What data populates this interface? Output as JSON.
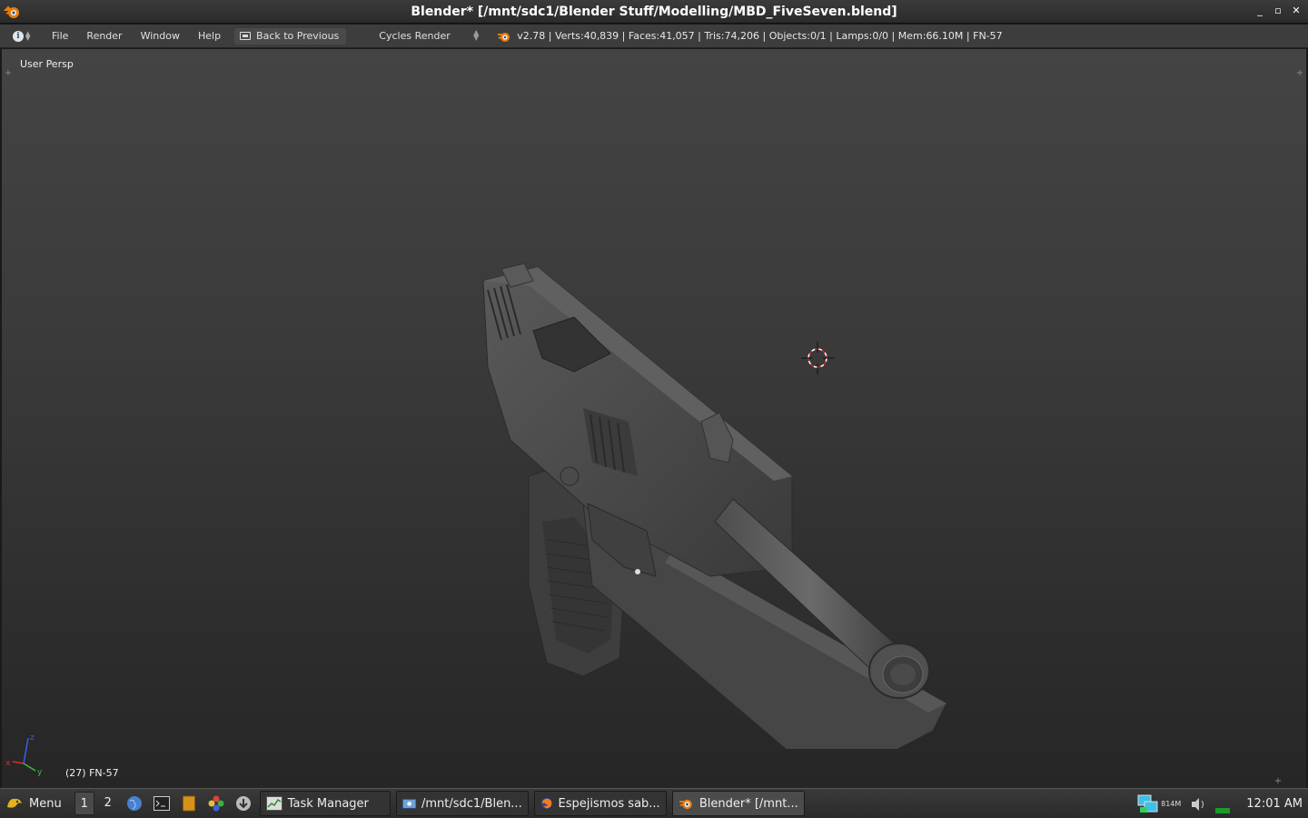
{
  "window": {
    "title": "Blender* [/mnt/sdc1/Blender Stuff/Modelling/MBD_FiveSeven.blend]",
    "minimize": "_",
    "maximize": "▫",
    "close": "✕"
  },
  "header": {
    "menus": [
      "File",
      "Render",
      "Window",
      "Help"
    ],
    "back_to_previous": "Back to Previous",
    "render_engine": "Cycles Render",
    "stats": "v2.78 | Verts:40,839 | Faces:41,057 | Tris:74,206 | Objects:0/1 | Lamps:0/0 | Mem:66.10M | FN-57"
  },
  "viewport": {
    "view_label": "User Persp",
    "object_label": "(27) FN-57",
    "axis_x": "x",
    "axis_y": "y",
    "axis_z": "z"
  },
  "taskbar": {
    "menu_label": "Menu",
    "workspaces": [
      "1",
      "2"
    ],
    "tasks": [
      {
        "label": "Task Manager",
        "icon": "task-manager-icon"
      },
      {
        "label": "/mnt/sdc1/Blen...",
        "icon": "file-manager-icon"
      },
      {
        "label": "Espejismos sab...",
        "icon": "firefox-icon"
      },
      {
        "label": "Blender* [/mnt...",
        "icon": "blender-icon"
      }
    ],
    "memory": "814M",
    "clock": "12:01 AM"
  },
  "colors": {
    "blender_orange": "#e87d0d",
    "blender_blue": "#265787",
    "viewport_top": "#444444",
    "viewport_bottom": "#262626"
  }
}
